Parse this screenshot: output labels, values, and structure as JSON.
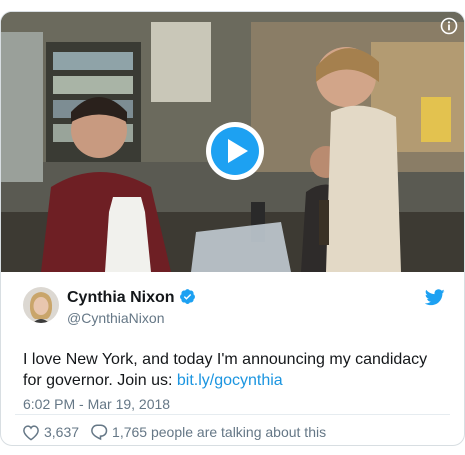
{
  "tweet": {
    "author": {
      "display_name": "Cynthia Nixon",
      "handle": "@CynthiaNixon",
      "verified_icon": "verified-badge-icon"
    },
    "text": "I love New York, and today I'm announcing my candidacy for governor. Join us: ",
    "link_text": "bit.ly/gocynthia",
    "timestamp": "6:02 PM - Mar 19, 2018",
    "likes": "3,637",
    "talking": "1,765 people are talking about this"
  },
  "colors": {
    "link": "#1b95e0",
    "verified": "#1da1f2",
    "play": "#1da1f2",
    "secondary_text": "#657786"
  },
  "icons": [
    "play-icon",
    "info-icon",
    "twitter-bird-icon",
    "heart-icon",
    "reply-bubble-icon"
  ]
}
